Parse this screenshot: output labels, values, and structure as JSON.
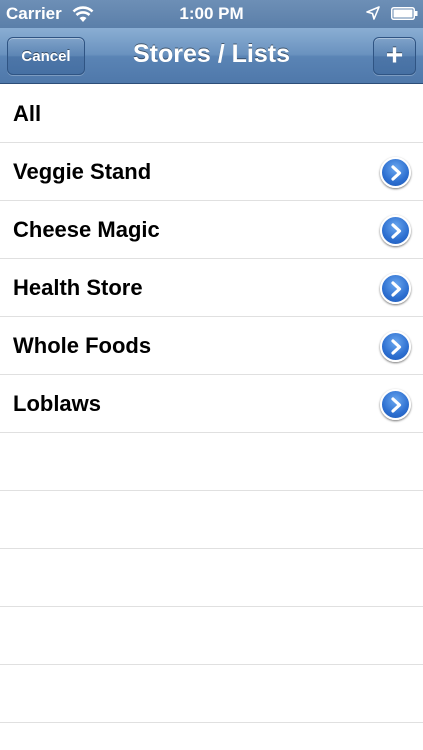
{
  "status_bar": {
    "carrier": "Carrier",
    "time": "1:00 PM",
    "icons": [
      "wifi-icon",
      "location-icon",
      "battery-icon"
    ]
  },
  "nav": {
    "title": "Stores / Lists",
    "cancel_label": "Cancel",
    "add_label": "+"
  },
  "list": {
    "items": [
      {
        "label": "All",
        "has_disclosure": false
      },
      {
        "label": "Veggie Stand",
        "has_disclosure": true
      },
      {
        "label": "Cheese Magic",
        "has_disclosure": true
      },
      {
        "label": "Health Store",
        "has_disclosure": true
      },
      {
        "label": "Whole Foods",
        "has_disclosure": true
      },
      {
        "label": "Loblaws",
        "has_disclosure": true
      }
    ]
  },
  "colors": {
    "nav_bar": "#5a84b5",
    "disclosure": "#2d6fd0"
  }
}
